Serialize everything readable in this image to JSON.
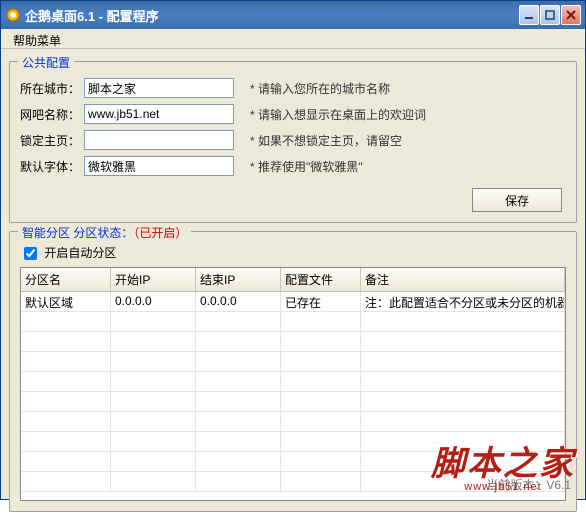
{
  "window": {
    "title": "企鹅桌面6.1 - 配置程序"
  },
  "menu": {
    "help": "帮助菜单"
  },
  "group1": {
    "legend": "公共配置",
    "city_label": "所在城市：",
    "city_value": "脚本之家",
    "city_hint": "* 请输入您所在的城市名称",
    "bar_label": "网吧名称：",
    "bar_value": "www.jb51.net",
    "bar_hint": "* 请输入想显示在桌面上的欢迎词",
    "lock_label": "锁定主页：",
    "lock_value": "",
    "lock_hint": "* 如果不想锁定主页，请留空",
    "font_label": "默认字体：",
    "font_value": "微软雅黑",
    "font_hint": "* 推荐使用\"微软雅黑\"",
    "save": "保存"
  },
  "group2": {
    "legend_prefix": "智能分区 分区状态：",
    "legend_status": "（已开启）",
    "checkbox_label": "开启自动分区",
    "checkbox_checked": true,
    "columns": [
      "分区名",
      "开始IP",
      "结束IP",
      "配置文件",
      "备注"
    ],
    "rows": [
      {
        "name": "默认区域",
        "start_ip": "0.0.0.0",
        "end_ip": "0.0.0.0",
        "config": "已存在",
        "note": "注：此配置适合不分区或未分区的机器"
      }
    ]
  },
  "footer": {
    "version": "当前版本：V6.1"
  },
  "watermark": {
    "big": "脚本之家",
    "small": "www.jb51.net"
  }
}
